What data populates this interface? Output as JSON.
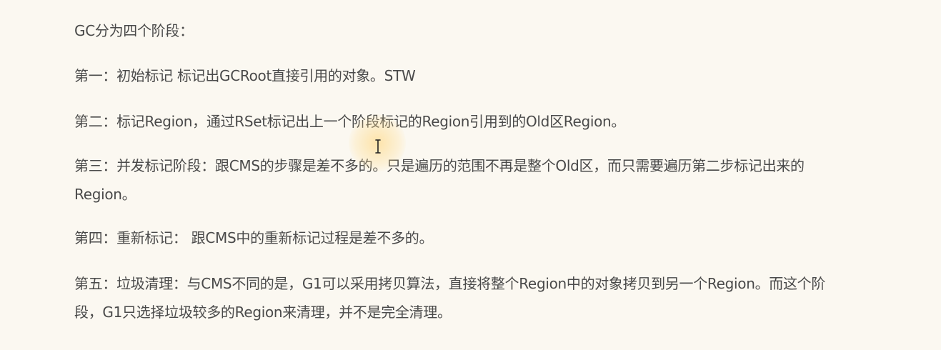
{
  "document": {
    "heading": "GC分为四个阶段：",
    "paragraphs": [
      {
        "lines": [
          "第一：初始标记 标记出GCRoot直接引用的对象。STW"
        ]
      },
      {
        "lines": [
          "第二：标记Region，通过RSet标记出上一个阶段标记的Region引用到的Old区Region。"
        ]
      },
      {
        "lines": [
          "第三：并发标记阶段：跟CMS的步骤是差不多的。只是遍历的范围不再是整个Old区，而只需要遍历第二步标记出来的",
          "Region。"
        ]
      },
      {
        "lines": [
          "第四：重新标记： 跟CMS中的重新标记过程是差不多的。"
        ]
      },
      {
        "lines": [
          "第五：垃圾清理：与CMS不同的是，G1可以采用拷贝算法，直接将整个Region中的对象拷贝到另一个Region。而这个阶",
          "段，G1只选择垃圾较多的Region来清理，并不是完全清理。"
        ]
      }
    ]
  },
  "overlay": {
    "cursor_icon": "text-cursor-icon",
    "highlight_color": "#ffd26e"
  }
}
